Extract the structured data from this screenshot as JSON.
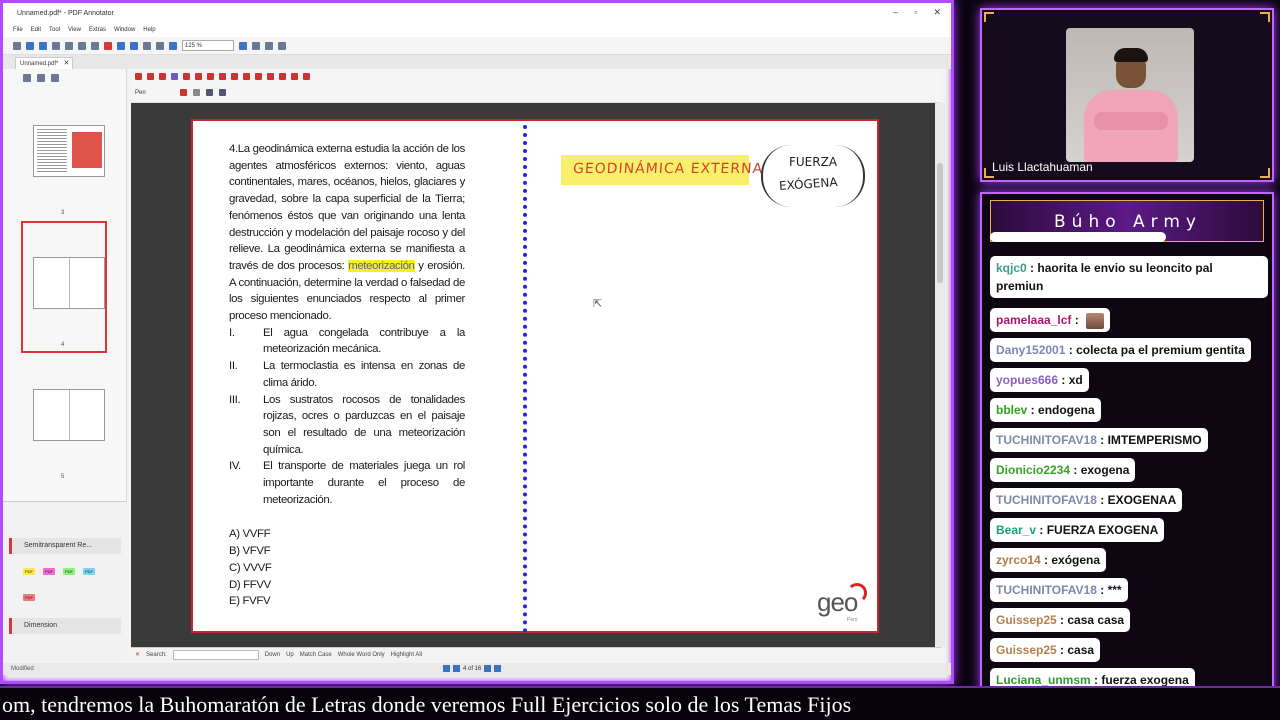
{
  "app": {
    "title": "Unnamed.pdf* - PDF Annotator",
    "menu": [
      "File",
      "Edit",
      "Tool",
      "View",
      "Extras",
      "Window",
      "Help"
    ],
    "zoom": "125 %",
    "doc_tab": "Unnamed.pdf*",
    "annot_mode": "Pen"
  },
  "sidepanel": {
    "thumb_numbers": [
      "3",
      "4",
      "5"
    ],
    "panel_semitransparent": "Semitransparent Re...",
    "panel_dimension": "Dimension",
    "chips": [
      "PDF",
      "PDF",
      "PDF",
      "PDF",
      "PDF"
    ]
  },
  "document": {
    "question_intro_a": "4.La geodinámica externa estudia la acción de los agentes atmosféricos externos: viento, aguas continentales, mares, océanos, hielos, glaciares y gravedad, sobre la capa superficial de la Tierra; fenómenos éstos que van originando una lenta destrucción y modelación del paisaje rocoso y del relieve. La geodinámica externa se manifiesta a través de dos procesos: ",
    "question_highlight": "meteorización",
    "question_intro_b": " y erosión. A continuación, determine la verdad o falsedad de los siguientes enunciados respecto al primer proceso mencionado.",
    "statements": [
      {
        "num": "I.",
        "text": "El agua congelada contribuye a la meteorización mecánica."
      },
      {
        "num": "II.",
        "text": "La termoclastia es intensa en zonas de clima árido."
      },
      {
        "num": "III.",
        "text": "Los sustratos rocosos de tonalidades rojizas, ocres o parduzcas en el paisaje son el resultado de una meteorización química."
      },
      {
        "num": "IV.",
        "text": "El transporte de materiales juega un rol importante durante el proceso de meteorización."
      }
    ],
    "options": [
      "A)  VVFF",
      "B)  VFVF",
      "C)  VVVF",
      "D)  FFVV",
      "E)  FVFV"
    ],
    "note_title": "GEODINÁMICA EXTERNA",
    "note_fuerza": "FUERZA",
    "note_exogena": "EXÓGENA",
    "logo": "geo",
    "logo_sub": "Perú"
  },
  "findbar": {
    "search_label": "Search:",
    "down": "Down",
    "up": "Up",
    "match_case": "Match Case",
    "whole_word": "Whole Word Only",
    "highlight_all": "Highlight All"
  },
  "status": {
    "label": "Modified",
    "page": "4 of 16"
  },
  "webcam": {
    "name": "Luis Llactahuaman"
  },
  "chat": {
    "title": "Búho Army",
    "messages": [
      {
        "user": "kqjc0",
        "color": "#3b9c8a",
        "text": "haorita le envio su leoncito pal premiun"
      },
      {
        "user": "pamelaaa_lcf",
        "color": "#b0126e",
        "text": ""
      },
      {
        "user": "Dany152001",
        "color": "#7a86b8",
        "text": "colecta pa el premium gentita"
      },
      {
        "user": "yopues666",
        "color": "#8a5fc0",
        "text": "xd"
      },
      {
        "user": "bblev",
        "color": "#2fa31c",
        "text": "endogena"
      },
      {
        "user": "TUCHINITOFAV18",
        "color": "#7c8aa8",
        "text": "IMTEMPERISMO"
      },
      {
        "user": "Dionicio2234",
        "color": "#3aa02a",
        "text": "exogena"
      },
      {
        "user": "TUCHINITOFAV18",
        "color": "#7c8aa8",
        "text": "EXOGENAA"
      },
      {
        "user": "Bear_v",
        "color": "#1aa07a",
        "text": "FUERZA EXOGENA"
      },
      {
        "user": "zyrco14",
        "color": "#b07a46",
        "text": "exógena"
      },
      {
        "user": "TUCHINITOFAV18",
        "color": "#7c8aa8",
        "text": "***"
      },
      {
        "user": "Guissep25",
        "color": "#b0824e",
        "text": "casa casa"
      },
      {
        "user": "Guissep25",
        "color": "#b0824e",
        "text": "casa"
      },
      {
        "user": "Luciana_unmsm",
        "color": "#2e9a3a",
        "text": "fuerza exogena"
      }
    ]
  },
  "ticker": {
    "text": "om, tendremos la Buhomaratón de Letras donde veremos Full Ejercicios solo de los Temas Fijos"
  },
  "colors": {
    "accent_purple": "#b04cff",
    "page_border": "#c6262e",
    "divider_blue": "#1a2ae0",
    "highlight_yellow": "#f6f01e"
  }
}
